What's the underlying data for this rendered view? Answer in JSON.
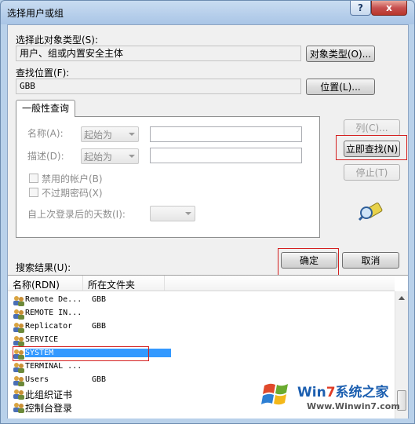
{
  "window": {
    "title": "选择用户或组",
    "help_label": "?",
    "close_label": "x"
  },
  "object_type": {
    "label": "选择此对象类型(S):",
    "value": "用户、组或内置安全主体",
    "button": "对象类型(O)..."
  },
  "location": {
    "label": "查找位置(F):",
    "value": "GBB",
    "button": "位置(L)..."
  },
  "tab": {
    "label": "一般性查询"
  },
  "query": {
    "name_label": "名称(A):",
    "name_mode": "起始为",
    "desc_label": "描述(D):",
    "desc_mode": "起始为",
    "disabled_accounts": "禁用的帐户(B)",
    "non_expiring_pwd": "不过期密码(X)",
    "days_label": "自上次登录后的天数(I):"
  },
  "side_buttons": {
    "columns": "列(C)...",
    "find_now": "立即查找(N)",
    "stop": "停止(T)"
  },
  "bottom_buttons": {
    "ok": "确定",
    "cancel": "取消"
  },
  "results": {
    "label": "搜索结果(U):",
    "headers": [
      "名称(RDN)",
      "所在文件夹"
    ],
    "rows": [
      {
        "name": "Remote De...",
        "folder": "GBB"
      },
      {
        "name": "REMOTE IN...",
        "folder": ""
      },
      {
        "name": "Replicator",
        "folder": "GBB"
      },
      {
        "name": "SERVICE",
        "folder": ""
      },
      {
        "name": "SYSTEM",
        "folder": ""
      },
      {
        "name": "TERMINAL ...",
        "folder": ""
      },
      {
        "name": "Users",
        "folder": "GBB"
      },
      {
        "name": "此组织证书",
        "folder": ""
      },
      {
        "name": "控制台登录",
        "folder": ""
      }
    ],
    "selected_row": "SYSTEM"
  },
  "watermark": {
    "brand_win": "Win",
    "brand_7": "7",
    "brand_cn": "系统之家",
    "url": "Www.Winwin7.com"
  },
  "colors": {
    "accent": "#3399ff",
    "highlight": "#d42020"
  }
}
